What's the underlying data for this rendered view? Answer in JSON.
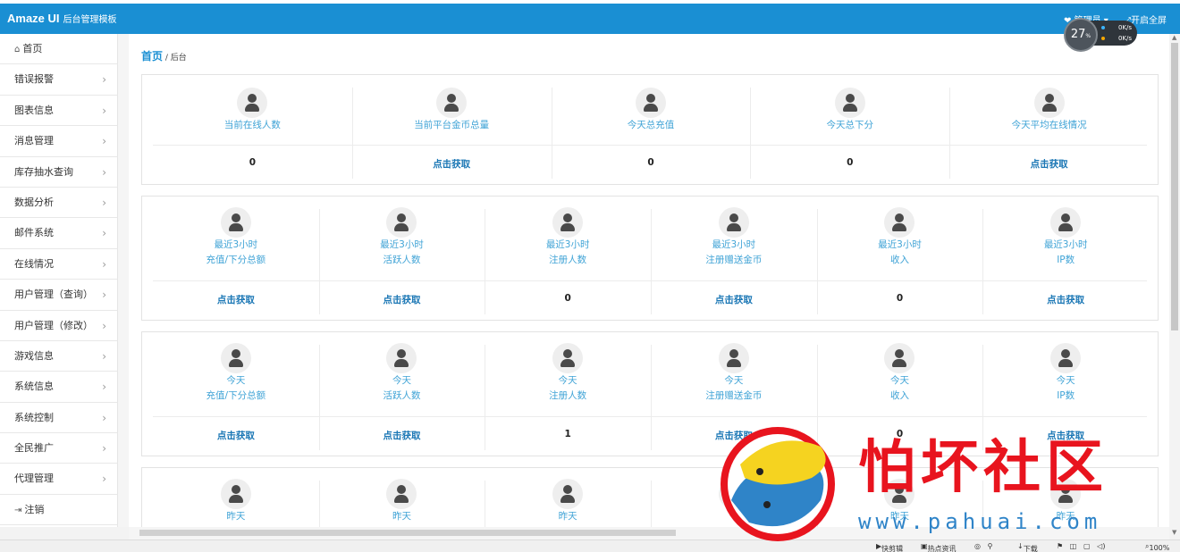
{
  "app": {
    "brand": "Amaze UI",
    "subtitle": "后台管理模板",
    "user_label": "管理员",
    "fullscreen_label": "开启全屏"
  },
  "net_widget": {
    "percent": "27",
    "unit": "%",
    "up": "0K/s",
    "down": "0K/s"
  },
  "sidebar": {
    "items": [
      {
        "label": "首页",
        "icon": "home-icon",
        "chevron": false
      },
      {
        "label": "错误报警",
        "chevron": true
      },
      {
        "label": "图表信息",
        "chevron": true
      },
      {
        "label": "消息管理",
        "chevron": true
      },
      {
        "label": "库存抽水查询",
        "chevron": true
      },
      {
        "label": "数据分析",
        "chevron": true
      },
      {
        "label": "邮件系统",
        "chevron": true
      },
      {
        "label": "在线情况",
        "chevron": true
      },
      {
        "label": "用户管理（查询）",
        "chevron": true
      },
      {
        "label": "用户管理（修改）",
        "chevron": true
      },
      {
        "label": "游戏信息",
        "chevron": true
      },
      {
        "label": "系统信息",
        "chevron": true
      },
      {
        "label": "系统控制",
        "chevron": true
      },
      {
        "label": "全民推广",
        "chevron": true
      },
      {
        "label": "代理管理",
        "chevron": true
      },
      {
        "label": "注销",
        "icon": "logout-icon",
        "chevron": false
      }
    ]
  },
  "breadcrumb": {
    "home": "首页",
    "sep": " / ",
    "current": "后台"
  },
  "panels": [
    {
      "cells": [
        {
          "label1": "当前在线人数",
          "label2": "",
          "value": "0",
          "link": false
        },
        {
          "label1": "当前平台金币总量",
          "label2": "",
          "value": "点击获取",
          "link": true
        },
        {
          "label1": "今天总充值",
          "label2": "",
          "value": "0",
          "link": false
        },
        {
          "label1": "今天总下分",
          "label2": "",
          "value": "0",
          "link": false
        },
        {
          "label1": "今天平均在线情况",
          "label2": "",
          "value": "点击获取",
          "link": true
        }
      ]
    },
    {
      "cells": [
        {
          "label1": "最近3小时",
          "label2": "充值/下分总额",
          "value": "点击获取",
          "link": true
        },
        {
          "label1": "最近3小时",
          "label2": "活跃人数",
          "value": "点击获取",
          "link": true
        },
        {
          "label1": "最近3小时",
          "label2": "注册人数",
          "value": "0",
          "link": false
        },
        {
          "label1": "最近3小时",
          "label2": "注册赠送金币",
          "value": "点击获取",
          "link": true
        },
        {
          "label1": "最近3小时",
          "label2": "收入",
          "value": "0",
          "link": false
        },
        {
          "label1": "最近3小时",
          "label2": "IP数",
          "value": "点击获取",
          "link": true
        }
      ]
    },
    {
      "cells": [
        {
          "label1": "今天",
          "label2": "充值/下分总额",
          "value": "点击获取",
          "link": true
        },
        {
          "label1": "今天",
          "label2": "活跃人数",
          "value": "点击获取",
          "link": true
        },
        {
          "label1": "今天",
          "label2": "注册人数",
          "value": "1",
          "link": false
        },
        {
          "label1": "今天",
          "label2": "注册赠送金币",
          "value": "点击获取",
          "link": true
        },
        {
          "label1": "今天",
          "label2": "收入",
          "value": "0",
          "link": false
        },
        {
          "label1": "今天",
          "label2": "IP数",
          "value": "点击获取",
          "link": true
        }
      ]
    },
    {
      "cells": [
        {
          "label1": "昨天",
          "label2": "",
          "value": "",
          "link": false
        },
        {
          "label1": "昨天",
          "label2": "",
          "value": "",
          "link": false
        },
        {
          "label1": "昨天",
          "label2": "",
          "value": "",
          "link": false
        },
        {
          "label1": "",
          "label2": "",
          "value": "",
          "link": false
        },
        {
          "label1": "昨天",
          "label2": "",
          "value": "",
          "link": false
        },
        {
          "label1": "昨天",
          "label2": "",
          "value": "",
          "link": false
        }
      ]
    }
  ],
  "statusbar": {
    "items": [
      "快剪辑",
      "热点资讯",
      "下载",
      "100%"
    ]
  },
  "watermark": {
    "text": "怕坏社区",
    "url": "www.pahuai.com"
  },
  "colors": {
    "topbar": "#1a8fd3",
    "accent": "#3fa3d6",
    "link": "#1b77b5",
    "watermark_red": "#e8141e"
  }
}
